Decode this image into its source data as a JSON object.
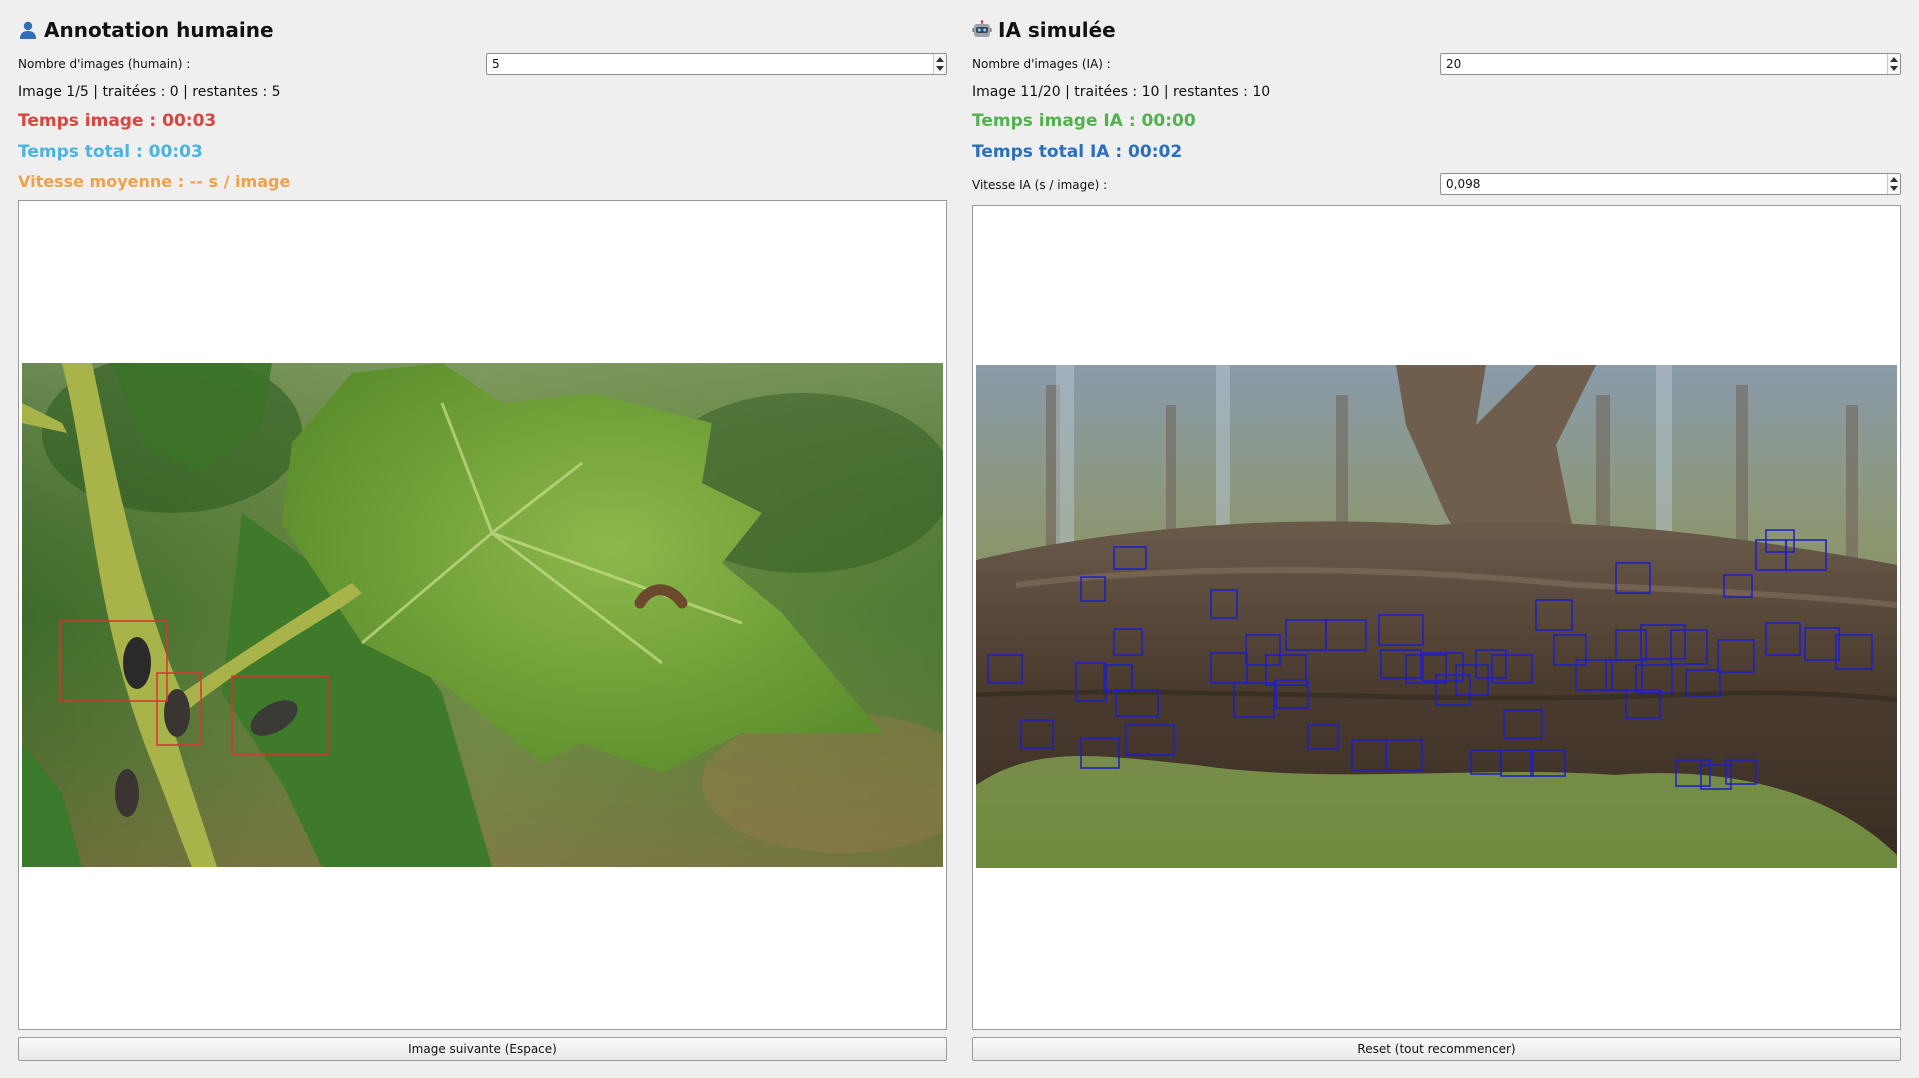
{
  "human": {
    "title": "Annotation humaine",
    "count_label": "Nombre d'images (humain) :",
    "count_value": "5",
    "progress": "Image 1/5 | traitées : 0 | restantes : 5",
    "time_image": "Temps image : 00:03",
    "time_total": "Temps total : 00:03",
    "avg_speed": "Vitesse moyenne : -- s / image",
    "next_button": "Image suivante (Espace)",
    "colors": {
      "time_image": "#d9453f",
      "time_total": "#4cb4dc",
      "avg_speed": "#eea24a",
      "box": "#e03030"
    }
  },
  "ai": {
    "title": "IA simulée",
    "count_label": "Nombre d'images (IA) :",
    "count_value": "20",
    "progress": "Image 11/20 | traitées : 10 | restantes : 10",
    "time_image": "Temps image IA : 00:00",
    "time_total": "Temps total IA : 00:02",
    "speed_label": "Vitesse IA (s / image) :",
    "speed_value": "0,098",
    "reset_button": "Reset (tout recommencer)",
    "colors": {
      "time_image": "#53b150",
      "time_total": "#2a6fbd",
      "box": "#1c1ccc"
    }
  },
  "icons": {
    "human": "user-icon",
    "ai": "robot-icon"
  }
}
